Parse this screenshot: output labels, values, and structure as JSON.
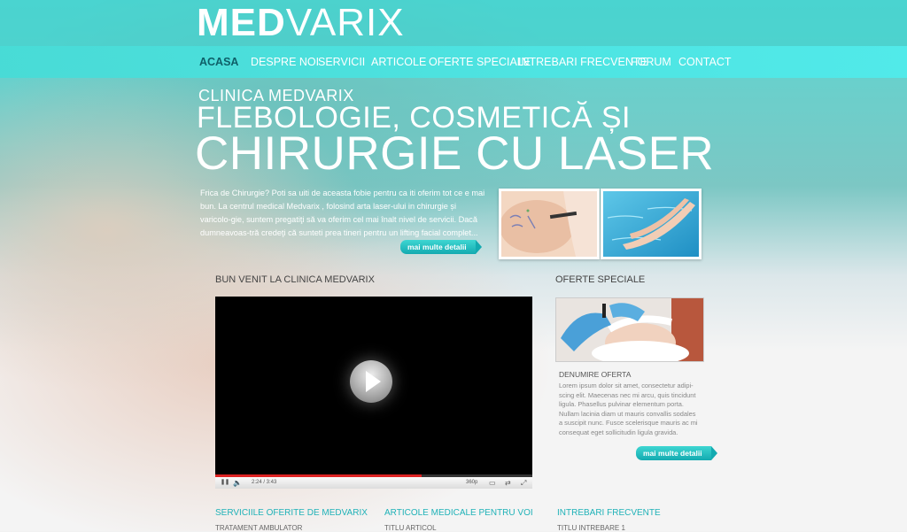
{
  "header": {
    "logo_bold": "MED",
    "logo_light": "VARIX"
  },
  "nav": {
    "items": [
      {
        "label": "ACASA",
        "active": true
      },
      {
        "label": "DESPRE NOI"
      },
      {
        "label": "SERVICII"
      },
      {
        "label": "ARTICOLE"
      },
      {
        "label": "OFERTE SPECIALE"
      },
      {
        "label": "INTREBARI FRECVENTE"
      },
      {
        "label": "FORUM"
      },
      {
        "label": "CONTACT"
      }
    ]
  },
  "hero": {
    "subtitle": "CLINICA MEDVARIX",
    "title_line1": "FLEBOLOGIE, COSMETICĂ ȘI",
    "title_line2": "CHIRURGIE CU LASER",
    "intro": "Frica de Chirurgie? Poti sa uiti de aceasta fobie pentru ca iti oferim tot ce e mai bun. La centrul medical Medvarix , folosind arta laser-ului in chirurgie și varicolo-gie, suntem pregatiţi să va oferim cel mai înalt nivel de servicii. Dacă dumneavoas-tră credeţi că sunteti prea tineri pentru un lifting facial complet...",
    "more_label": "mai multe detalii"
  },
  "welcome": {
    "title": "BUN VENIT LA CLINICA MEDVARIX",
    "video": {
      "time": "2:24 / 3:43",
      "quality": "360p",
      "progress": 0.65
    }
  },
  "offers": {
    "title": "OFERTE SPECIALE",
    "name": "DENUMIRE OFERTA",
    "text": "Lorem ipsum dolor sit amet, consectetur adipi-scing elit. Maecenas nec mi arcu, quis tincidunt ligula. Phasellus pulvinar elementum porta. Nullam lacinia diam ut mauris convallis sodales a suscipit nunc. Fusce scelerisque mauris ac mi consequat eget sollicitudin ligula gravida.",
    "more_label": "mai multe detalii"
  },
  "footer": {
    "col1_title": "SERVICIILE OFERITE DE MEDVARIX",
    "col1_sub": "TRATAMENT AMBULATOR",
    "col2_title": "ARTICOLE MEDICALE PENTRU VOI",
    "col2_sub": "TITLU ARTICOL",
    "col3_title": "INTREBARI FRECVENTE",
    "col3_sub": "TITLU INTREBARE 1"
  },
  "colors": {
    "accent": "#20b2b8",
    "nav_active": "#0e5f68"
  }
}
